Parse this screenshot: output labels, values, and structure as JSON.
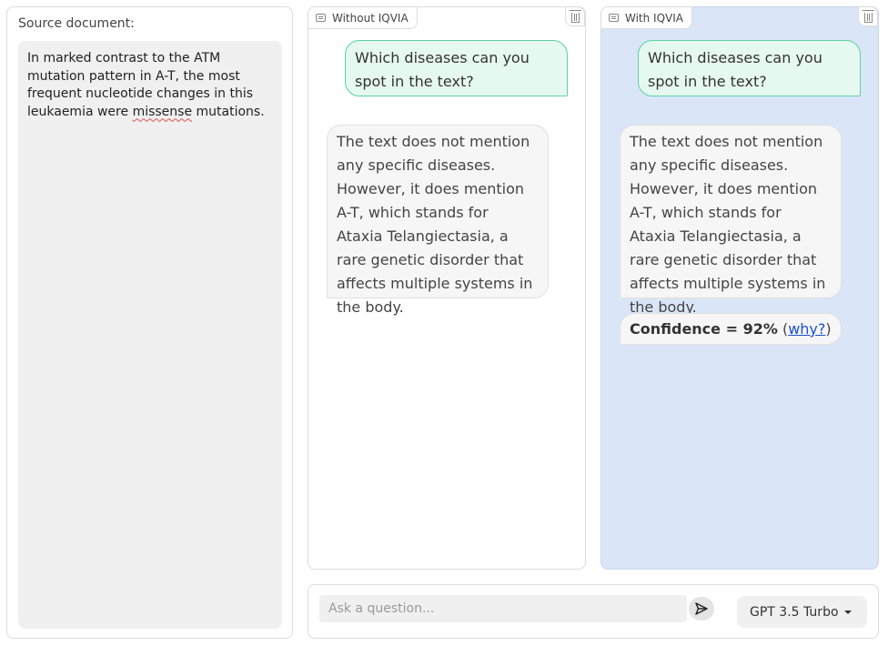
{
  "source": {
    "label": "Source document:",
    "text_before": "In marked contrast to the ATM mutation pattern in A-T, the most frequent nucleotide changes in this leukaemia were ",
    "misspelled_word": "missense",
    "text_after": " mutations."
  },
  "panels": {
    "without": {
      "tab_label": "Without IQVIA",
      "user_message": "Which diseases can you spot in the text?",
      "bot_message": "The text does not mention any specific diseases. However, it does mention A-T, which stands for Ataxia Telangiectasia, a rare genetic disorder that affects multiple systems in the body."
    },
    "with": {
      "tab_label": "With IQVIA",
      "user_message": "Which diseases can you spot in the text?",
      "bot_message": "The text does not mention any specific diseases. However, it does mention A-T, which stands for Ataxia Telangiectasia, a rare genetic disorder that affects multiple systems in the body.",
      "confidence_label": "Confidence = 92%",
      "why_link": "why?"
    }
  },
  "input": {
    "placeholder": "Ask a question...",
    "value": ""
  },
  "model_selector": {
    "selected": "GPT 3.5 Turbo"
  },
  "icons": {
    "chat_tab": "chat-icon",
    "clear": "trash-icon",
    "send": "send-icon",
    "dropdown": "caret-down-icon"
  },
  "colors": {
    "user_bubble_bg": "#e6f9f0",
    "user_bubble_border": "#5bd1a5",
    "with_panel_bg": "#dae6f7",
    "link": "#1a4fd6"
  }
}
